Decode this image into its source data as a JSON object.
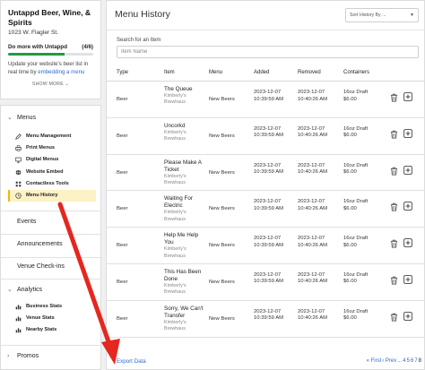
{
  "venue": {
    "name": "Untappd Beer, Wine, & Spirits",
    "address": "1023 W. Flagler St.",
    "upsell_title": "Do more with Untappd",
    "upsell_progress": "(4/6)",
    "upsell_fraction": 0.667,
    "upsell_text": "Update your website's beer list in real time by",
    "upsell_link": "embedding a menu",
    "show_more": "SHOW MORE ⌄"
  },
  "nav": {
    "menus": "Menus",
    "menu_items": [
      {
        "label": "Menu Management",
        "icon": "pencil-icon"
      },
      {
        "label": "Print Menus",
        "icon": "printer-icon"
      },
      {
        "label": "Digital Menus",
        "icon": "monitor-icon"
      },
      {
        "label": "Website Embed",
        "icon": "globe-icon"
      },
      {
        "label": "Contactless Tools",
        "icon": "grid-icon"
      },
      {
        "label": "Menu History",
        "icon": "clock-icon",
        "active": true
      }
    ],
    "events": "Events",
    "announcements": "Announcements",
    "checkins": "Venue Check-ins",
    "analytics": "Analytics",
    "analytics_items": [
      {
        "label": "Business Stats",
        "icon": "chart-icon"
      },
      {
        "label": "Venue Stats",
        "icon": "chart-icon"
      },
      {
        "label": "Nearby Stats",
        "icon": "chart-icon"
      }
    ],
    "promos": "Promos"
  },
  "main": {
    "title": "Menu History",
    "sort_label": "Sort History By ...",
    "search_label": "Search for an Item",
    "search_placeholder": "Item Name",
    "columns": [
      "Type",
      "Item",
      "Menu",
      "Added",
      "Removed",
      "Containers"
    ],
    "rows": [
      {
        "type": "Beer",
        "item": "The Queue",
        "vendor": "Kimberly's Brewhaus",
        "menu": "New Beers",
        "added_date": "2023-12-07",
        "added_time": "10:39:59 AM",
        "removed_date": "2023-12-07",
        "removed_time": "10:40:26 AM",
        "container": "16oz Draft",
        "price": "$6.00"
      },
      {
        "type": "Beer",
        "item": "Uncorkd",
        "vendor": "Kimberly's Brewhaus",
        "menu": "New Beers",
        "added_date": "2023-12-07",
        "added_time": "10:39:59 AM",
        "removed_date": "2023-12-07",
        "removed_time": "10:40:26 AM",
        "container": "16oz Draft",
        "price": "$6.00"
      },
      {
        "type": "Beer",
        "item": "Please Make A Ticket",
        "vendor": "Kimberly's Brewhaus",
        "menu": "New Beers",
        "added_date": "2023-12-07",
        "added_time": "10:39:59 AM",
        "removed_date": "2023-12-07",
        "removed_time": "10:40:26 AM",
        "container": "16oz Draft",
        "price": "$6.00"
      },
      {
        "type": "Beer",
        "item": "Waiting For Electric",
        "vendor": "Kimberly's Brewhaus",
        "menu": "New Beers",
        "added_date": "2023-12-07",
        "added_time": "10:39:59 AM",
        "removed_date": "2023-12-07",
        "removed_time": "10:40:26 AM",
        "container": "16oz Draft",
        "price": "$6.00"
      },
      {
        "type": "Beer",
        "item": "Help Me Help You",
        "vendor": "Kimberly's Brewhaus",
        "menu": "New Beers",
        "added_date": "2023-12-07",
        "added_time": "10:39:59 AM",
        "removed_date": "2023-12-07",
        "removed_time": "10:40:26 AM",
        "container": "16oz Draft",
        "price": "$6.00"
      },
      {
        "type": "Beer",
        "item": "This Has Been Done",
        "vendor": "Kimberly's Brewhaus",
        "menu": "New Beers",
        "added_date": "2023-12-07",
        "added_time": "10:39:59 AM",
        "removed_date": "2023-12-07",
        "removed_time": "10:40:26 AM",
        "container": "16oz Draft",
        "price": "$6.00"
      },
      {
        "type": "Beer",
        "item": "Sorry, We Can't Transfer",
        "vendor": "Kimberly's Brewhaus",
        "menu": "New Beers",
        "added_date": "2023-12-07",
        "added_time": "10:39:59 AM",
        "removed_date": "2023-12-07",
        "removed_time": "10:40:26 AM",
        "container": "16oz Draft",
        "price": "$6.00"
      }
    ],
    "export_label": "Export Data",
    "pagination": [
      "« First",
      "‹ Prev",
      "...",
      "4",
      "5",
      "6",
      "7",
      "8"
    ],
    "pagination_current": "8"
  },
  "colors": {
    "accent_link": "#2e6bc9",
    "progress_green": "#1f9d3d",
    "active_highlight": "#fdf1c6",
    "annotation_arrow": "#e5271f"
  }
}
